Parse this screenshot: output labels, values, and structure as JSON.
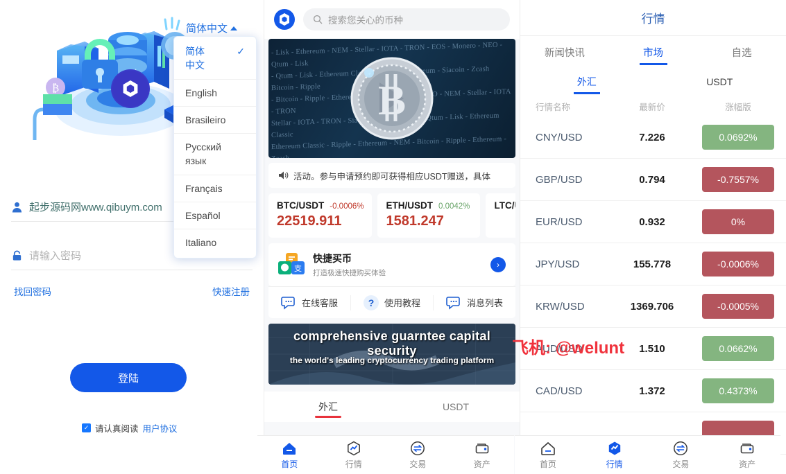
{
  "login": {
    "language_selector": {
      "current": "简体中文",
      "caret": "caret-up-icon"
    },
    "languages": [
      {
        "label": "简体\n中文",
        "selected": true,
        "check": "✓"
      },
      {
        "label": "English",
        "selected": false,
        "check": ""
      },
      {
        "label": "Brasileiro",
        "selected": false,
        "check": ""
      },
      {
        "label": "Русский\nязык",
        "selected": false,
        "check": ""
      },
      {
        "label": "Français",
        "selected": false,
        "check": ""
      },
      {
        "label": "Español",
        "selected": false,
        "check": ""
      },
      {
        "label": "Italiano",
        "selected": false,
        "check": ""
      }
    ],
    "username_value": "起步源码网www.qibuym.com",
    "password_placeholder": "请输入密码",
    "forgot_label": "找回密码",
    "register_label": "快速注册",
    "submit_label": "登陆",
    "agree_text": "请认真阅读",
    "agree_link": "用户协议",
    "checkbox_checked": "✓"
  },
  "middle": {
    "search_placeholder": "搜索您关心的币种",
    "hero_text": "- Lisk - Ethereum - NEM - Stellar - IOTA - TRON - EOS - Monero - NEO - Qtum - Lisk\n- Qtum - Lisk - Ethereum Classic - Ripple - Ethereum - Siacoin - Zcash Bitcoin - Ripple\n- Bitcoin - Ripple - Ethereum - Zcash - Monero - NEO - NEM - Stellar - IOTA - TRON\nStellar - IOTA - TRON - Siacoin - Zcash Bitcoin - Qtum - Lisk - Ethereum Classic\nEthereum Classic - Ripple - Ethereum - NEM - Bitcoin - Ripple - Ethereum - Zcash\n- Ripple - Ethereum - Monero - NEO - Qtum - Stellar - IOTA - TRON - Siacoin - Zcash\nTRON - Siacoin - Zcash - Bitcoin - Ripple - Ethereum - NEM - Stellar - IOTA - TRON",
    "notice_text": "活动。参与申请预约即可获得相应USDT赠送，具体",
    "tickers": [
      {
        "pair": "BTC/USDT",
        "change": "-0.0006%",
        "dir": "down",
        "price": "22519.911"
      },
      {
        "pair": "ETH/USDT",
        "change": "0.0042%",
        "dir": "up",
        "price": "1581.247"
      },
      {
        "pair": "LTC/USDT",
        "change": "",
        "dir": "up",
        "price": ""
      }
    ],
    "quick_buy": {
      "title": "快捷买币",
      "subtitle": "打造极速快捷购买体验",
      "arrow": "›"
    },
    "shortcuts": [
      {
        "label": "在线客服",
        "icon": "chat-support-icon"
      },
      {
        "label": "使用教程",
        "icon": "question-mark-icon"
      },
      {
        "label": "消息列表",
        "icon": "message-list-icon"
      }
    ],
    "promo": {
      "line1": "comprehensive guarntee capital security",
      "line2": "the world's leading cryptocurrency trading platform"
    },
    "market_tabs": [
      {
        "label": "外汇",
        "active": true
      },
      {
        "label": "USDT",
        "active": false
      }
    ],
    "bottom_nav": [
      {
        "label": "首页",
        "icon": "home-icon",
        "active": true
      },
      {
        "label": "行情",
        "icon": "quote-icon",
        "active": false
      },
      {
        "label": "交易",
        "icon": "trade-icon",
        "active": false
      },
      {
        "label": "资产",
        "icon": "assets-icon",
        "active": false
      }
    ]
  },
  "right": {
    "title": "行情",
    "tabs": [
      {
        "label": "新闻快讯",
        "active": false
      },
      {
        "label": "市场",
        "active": true
      },
      {
        "label": "自选",
        "active": false
      }
    ],
    "subtabs": [
      {
        "label": "外汇",
        "active": true
      },
      {
        "label": "USDT",
        "active": false
      }
    ],
    "columns": {
      "name": "行情名称",
      "price": "最新价",
      "change": "涨幅版"
    },
    "rows": [
      {
        "name": "CNY/USD",
        "price": "7.226",
        "change": "0.0692%",
        "dir": "up"
      },
      {
        "name": "GBP/USD",
        "price": "0.794",
        "change": "-0.7557%",
        "dir": "down"
      },
      {
        "name": "EUR/USD",
        "price": "0.932",
        "change": "0%",
        "dir": "down"
      },
      {
        "name": "JPY/USD",
        "price": "155.778",
        "change": "-0.0006%",
        "dir": "down"
      },
      {
        "name": "KRW/USD",
        "price": "1369.706",
        "change": "-0.0005%",
        "dir": "down"
      },
      {
        "name": "AUD/USD",
        "price": "1.510",
        "change": "0.0662%",
        "dir": "up"
      },
      {
        "name": "CAD/USD",
        "price": "1.372",
        "change": "0.4373%",
        "dir": "up"
      },
      {
        "name": "",
        "price": "",
        "change": "",
        "dir": "down"
      }
    ],
    "bottom_nav": [
      {
        "label": "首页",
        "icon": "home-icon",
        "active": false
      },
      {
        "label": "行情",
        "icon": "quote-icon",
        "active": true
      },
      {
        "label": "交易",
        "icon": "trade-icon",
        "active": false
      },
      {
        "label": "资产",
        "icon": "assets-icon",
        "active": false
      }
    ]
  },
  "watermark": {
    "text": "飞机: @welunt",
    "color": "#f0323c"
  }
}
